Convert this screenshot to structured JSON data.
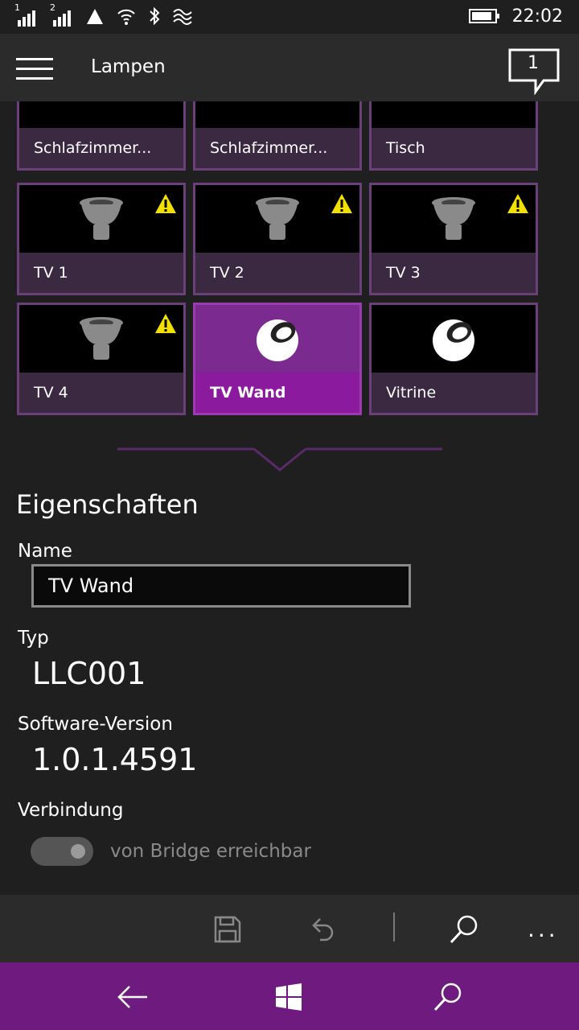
{
  "status": {
    "sim1": "1",
    "sim2": "2",
    "battery_level": 0.9,
    "time": "22:02"
  },
  "appbar": {
    "title": "Lampen",
    "notification_count": "1"
  },
  "tiles": [
    {
      "label": "Schlafzimmer...",
      "icon": "round-bulb-icon",
      "warning": false,
      "selected": false
    },
    {
      "label": "Schlafzimmer...",
      "icon": "candle-bulb-icon",
      "warning": false,
      "selected": false
    },
    {
      "label": "Tisch",
      "icon": "round-bulb-icon",
      "warning": false,
      "selected": false
    },
    {
      "label": "TV 1",
      "icon": "spot-bulb-icon",
      "warning": true,
      "selected": false
    },
    {
      "label": "TV 2",
      "icon": "spot-bulb-icon",
      "warning": true,
      "selected": false
    },
    {
      "label": "TV 3",
      "icon": "spot-bulb-icon",
      "warning": true,
      "selected": false
    },
    {
      "label": "TV 4",
      "icon": "spot-bulb-icon",
      "warning": true,
      "selected": false
    },
    {
      "label": "TV Wand",
      "icon": "living-colors-icon",
      "warning": false,
      "selected": true
    },
    {
      "label": "Vitrine",
      "icon": "living-colors-icon",
      "warning": false,
      "selected": false
    }
  ],
  "properties": {
    "title": "Eigenschaften",
    "name_label": "Name",
    "name_value": "TV Wand",
    "type_label": "Typ",
    "type_value": "LLC001",
    "software_label": "Software-Version",
    "software_value": "1.0.1.4591",
    "connection_label": "Verbindung",
    "connection_text": "von Bridge erreichbar",
    "connection_on": true
  },
  "commandbar": {
    "more": "..."
  },
  "colors": {
    "accent": "#8b1a9f",
    "nav": "#6f1a7f",
    "warning": "#f2e100"
  }
}
